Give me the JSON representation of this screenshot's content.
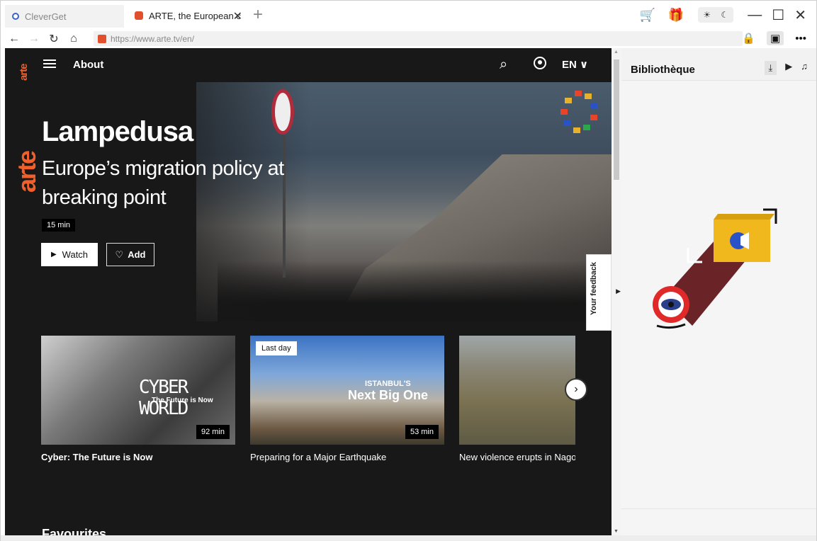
{
  "tabs": [
    {
      "label": "CleverGet"
    },
    {
      "label": "ARTE, the European c"
    }
  ],
  "address": {
    "url": "https://www.arte.tv/en/"
  },
  "site": {
    "logo_text": "arte",
    "nav_about": "About",
    "lang": "EN",
    "hero": {
      "title": "Lampedusa",
      "subtitle": "Europe’s migration policy at breaking point",
      "duration": "15 min",
      "watch_label": "Watch",
      "add_label": "Add"
    },
    "cards": [
      {
        "title": "Cyber: The Future is Now",
        "duration": "92 min",
        "thumb_text": "CYBER WORLD",
        "thumb_sub": "The Future is Now"
      },
      {
        "title": "Preparing for a Major Earthquake",
        "duration": "53 min",
        "badge": "Last day",
        "thumb_text_top": "ISTANBUL'S",
        "thumb_text_main": "Next Big One"
      },
      {
        "title": "New violence erupts in Nagor"
      }
    ],
    "section_title": "Favourites",
    "feedback_label": "Your feedback"
  },
  "panel": {
    "title": "Bibliothèque"
  },
  "colors": {
    "arte_orange": "#f1602a",
    "accent_red": "#e84a3a",
    "panel_bg": "#f5f5f5"
  }
}
